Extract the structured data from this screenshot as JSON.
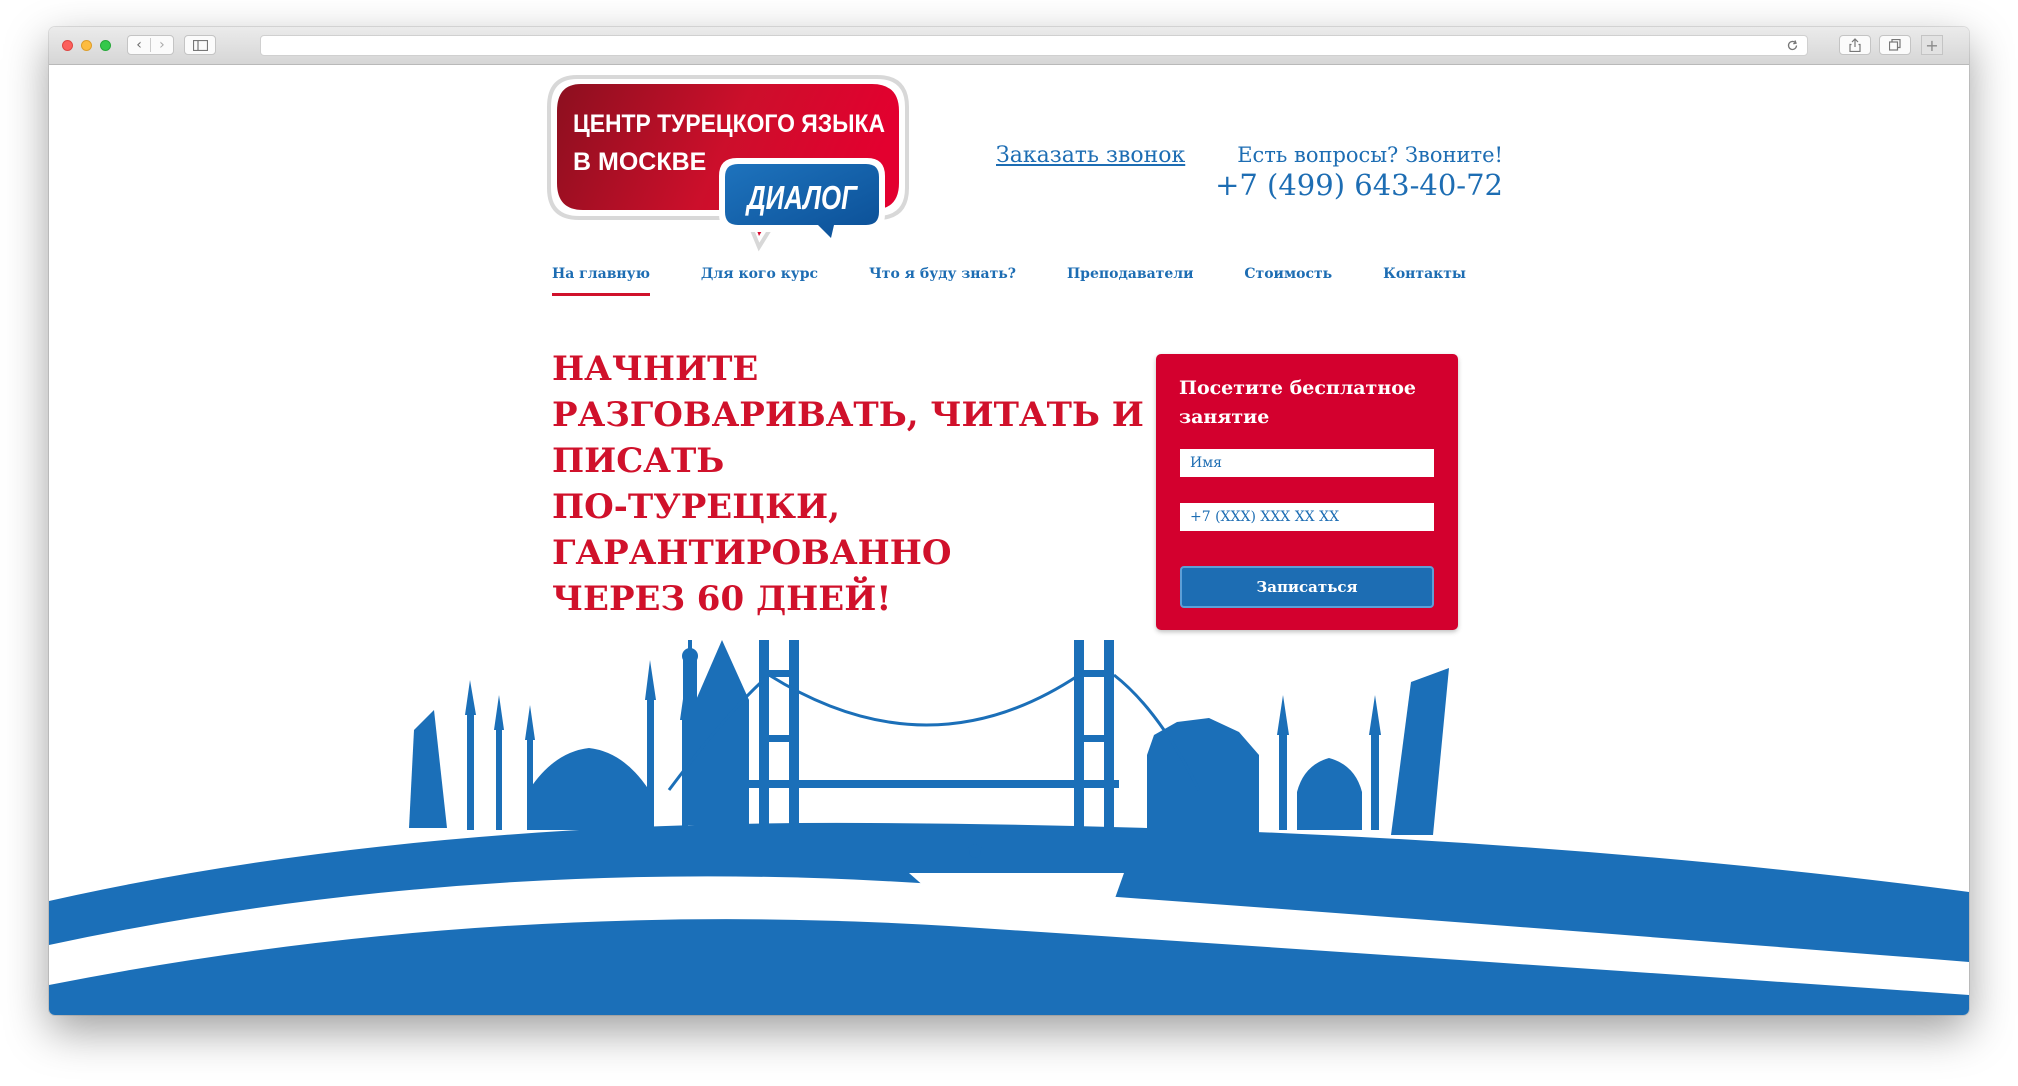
{
  "colors": {
    "brand_red": "#d0112b",
    "brand_blue": "#1d6db3",
    "form_red": "#d3002e"
  },
  "logo": {
    "line1": "ЦЕНТР ТУРЕЦКОГО ЯЗЫКА",
    "line2": "В МОСКВЕ",
    "brand": "ДИАЛОГ"
  },
  "header": {
    "callback_link": "Заказать звонок",
    "questions": "Есть вопросы? Звоните!",
    "phone": "+7 (499) 643-40-72"
  },
  "nav": {
    "items": [
      {
        "label": "На главную",
        "active": true
      },
      {
        "label": "Для кого курс"
      },
      {
        "label": "Что я буду знать?"
      },
      {
        "label": "Преподаватели"
      },
      {
        "label": "Стоимость"
      },
      {
        "label": "Контакты"
      }
    ]
  },
  "hero": {
    "line1": "Начните",
    "line2": "разговаривать, читать и писать",
    "line3": "по-турецки, гарантированно",
    "line4": "через 60 дней!"
  },
  "form": {
    "title": "Посетите бесплатное занятие",
    "name_placeholder": "Имя",
    "phone_placeholder": "+7 (XXX) XXX XX XX",
    "submit_label": "Записаться"
  }
}
